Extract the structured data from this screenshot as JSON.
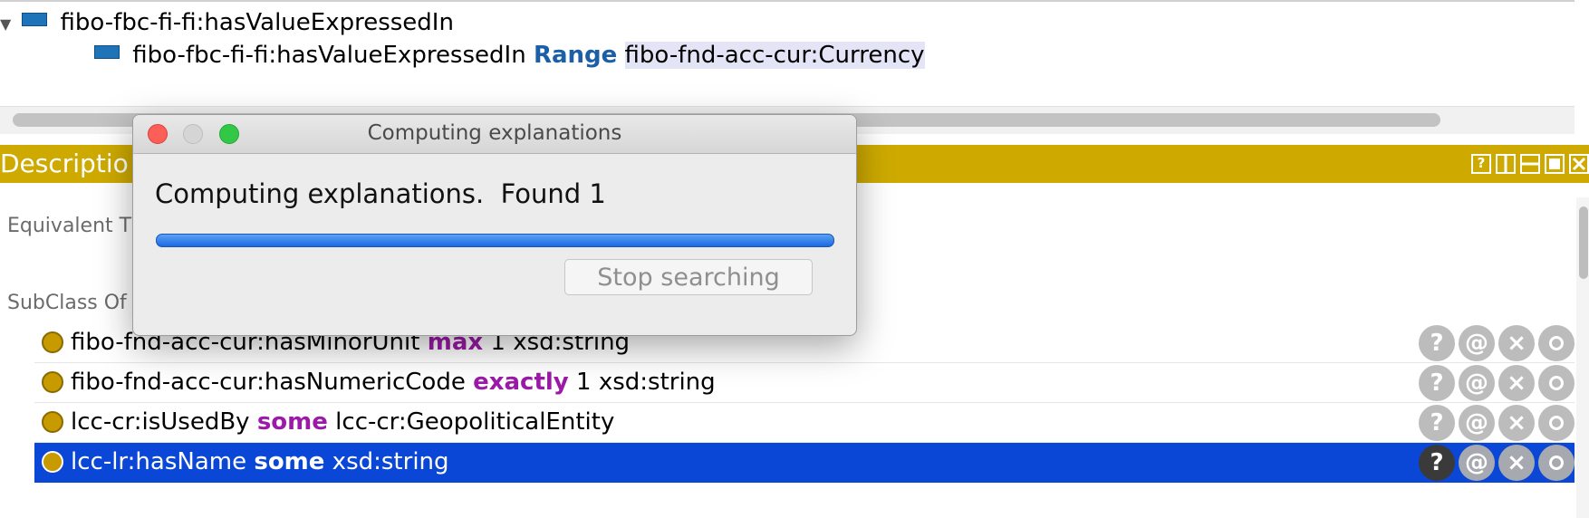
{
  "tree": {
    "row1": {
      "text": "fibo-fbc-fi-fi:hasValueExpressedIn"
    },
    "row2": {
      "property": "fibo-fbc-fi-fi:hasValueExpressedIn",
      "keyword": "Range",
      "value": "fibo-fnd-acc-cur:Currency"
    }
  },
  "description": {
    "title": "Descriptio",
    "sections": {
      "equivalent_to": "Equivalent T",
      "subclass_of": "SubClass Of"
    },
    "rows": [
      {
        "prefix": "fibo-fnd-acc-cur:hasMinorUnit ",
        "keyword": "max",
        "suffix": " 1 xsd:string"
      },
      {
        "prefix": "fibo-fnd-acc-cur:hasNumericCode ",
        "keyword": "exactly",
        "suffix": " 1 xsd:string"
      },
      {
        "prefix": "lcc-cr:isUsedBy ",
        "keyword": "some",
        "suffix": " lcc-cr:GeopoliticalEntity"
      },
      {
        "prefix": "lcc-lr:hasName ",
        "keyword": "some",
        "suffix": " xsd:string"
      }
    ],
    "selected_row": 3,
    "row_buttons": {
      "help": "?",
      "annotate": "@",
      "delete": "×"
    }
  },
  "view_controls": {
    "help": "?"
  },
  "dialog": {
    "title": "Computing explanations",
    "message": "Computing explanations.  Found 1",
    "progress": 1.0,
    "stop_label": "Stop searching"
  },
  "colors": {
    "header_gold": "#ceaa00",
    "selection_blue": "#0a47d6",
    "keyword_purple": "#9b1aa8",
    "range_blue": "#1a5fa8"
  }
}
